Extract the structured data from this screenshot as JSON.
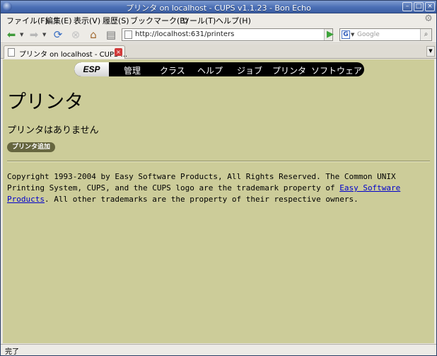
{
  "window": {
    "title": "プリンタ on localhost - CUPS v1.1.23 - Bon Echo"
  },
  "menu": {
    "items": [
      "ファイル(F)",
      "編集(E)",
      "表示(V)",
      "履歴(S)",
      "ブックマーク(B)",
      "ツール(T)",
      "ヘルプ(H)"
    ]
  },
  "toolbar": {
    "url": "http://localhost:631/printers",
    "search_placeholder": "Google"
  },
  "tabs": [
    {
      "label": "プリンタ on localhost - CUPS ..."
    }
  ],
  "cups_nav": {
    "logo": "ESP",
    "links": [
      "管理",
      "クラス",
      "ヘルプ",
      "ジョブ",
      "プリンタ",
      "ソフトウェア"
    ]
  },
  "page": {
    "heading": "プリンタ",
    "empty_message": "プリンタはありません",
    "add_button": "プリンタ追加",
    "copyright_before": "Copyright 1993-2004 by Easy Software Products, All Rights Reserved. The Common UNIX Printing System, CUPS, and the CUPS logo are the trademark property of ",
    "copyright_link": "Easy Software Products",
    "copyright_after": ". All other trademarks are the property of their respective owners."
  },
  "status": {
    "text": "完了"
  },
  "colors": {
    "content_bg": "#cccc99",
    "add_button_bg": "#66663f",
    "link": "#0000cc"
  }
}
